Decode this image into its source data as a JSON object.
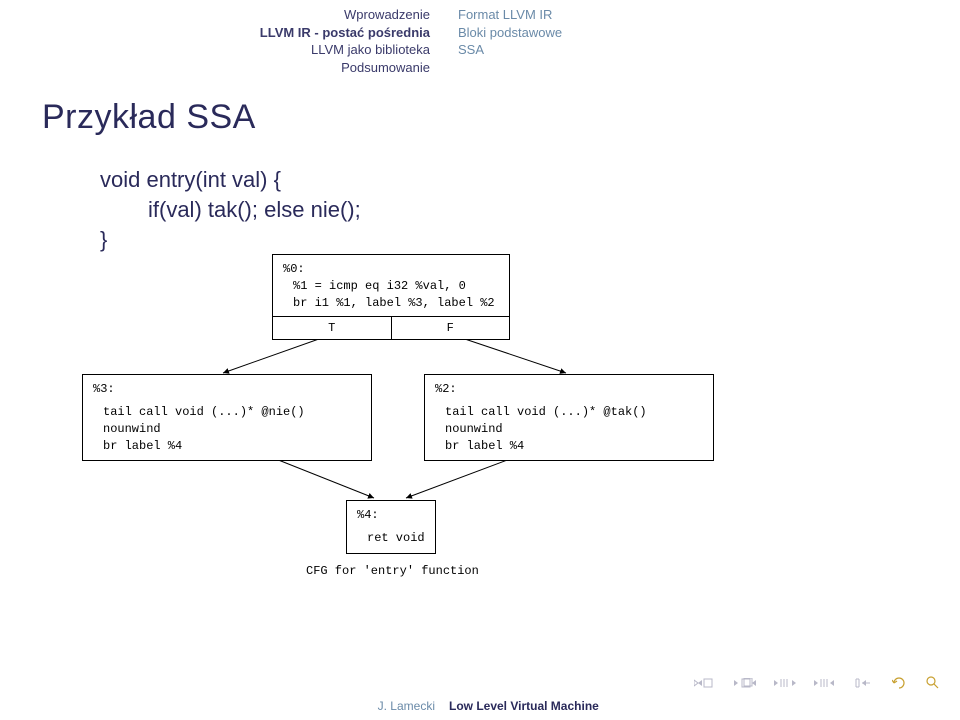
{
  "header": {
    "left": [
      "Wprowadzenie",
      "LLVM IR - postać pośrednia",
      "LLVM jako biblioteka",
      "Podsumowanie"
    ],
    "right": [
      "Format LLVM IR",
      "Bloki podstawowe",
      "SSA"
    ]
  },
  "title": "Przykład SSA",
  "code": {
    "l1": "void entry(int val) {",
    "l2": "if(val) tak(); else nie();",
    "l3": "}"
  },
  "blocks": {
    "b0": {
      "label": "%0:",
      "l1": "%1 = icmp eq i32 %val, 0",
      "l2": "br i1 %1, label %3, label %2",
      "t": "T",
      "f": "F"
    },
    "b3": {
      "label": "%3:",
      "l1": "tail call void (...)* @nie() nounwind",
      "l2": "br label %4"
    },
    "b2": {
      "label": "%2:",
      "l1": "tail call void (...)* @tak() nounwind",
      "l2": "br label %4"
    },
    "b4": {
      "label": "%4:",
      "l1": "ret void"
    }
  },
  "cfg_caption": "CFG for 'entry' function",
  "footer": {
    "author": "J. Lamecki",
    "title": "Low Level Virtual Machine"
  }
}
